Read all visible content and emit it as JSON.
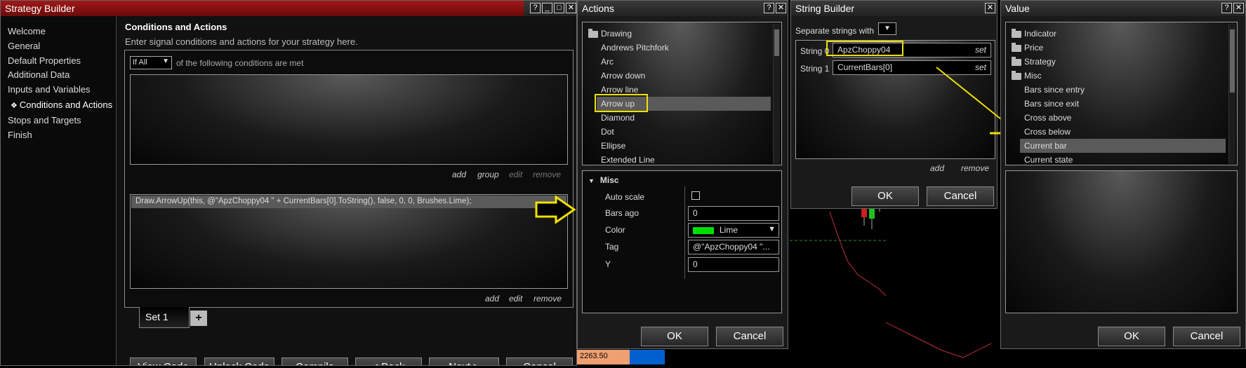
{
  "strategy_builder": {
    "title": "Strategy Builder",
    "title_buttons": [
      "?",
      "_",
      "□",
      "✕"
    ],
    "nav": [
      "Welcome",
      "General",
      "Default Properties",
      "Additional Data",
      "Inputs and Variables",
      "Conditions and Actions",
      "Stops and Targets",
      "Finish"
    ],
    "active_nav_bullet": "❖",
    "section_title": "Conditions and Actions",
    "section_subtitle": "Enter signal conditions and actions for your strategy here.",
    "condition_select": "If All",
    "condition_text": "of the following conditions are met",
    "conditions_links": {
      "add": "add",
      "group": "group",
      "edit": "edit",
      "remove": "remove"
    },
    "action_row": "Draw.ArrowUp(this, @\"ApzChoppy04 \" + CurrentBars[0].ToString(), false, 0, 0, Brushes.Lime);",
    "actions_links": {
      "add": "add",
      "edit": "edit",
      "remove": "remove"
    },
    "set_tab": "Set 1",
    "add_set": "+",
    "bottom_buttons": [
      "View Code",
      "Unlock Code",
      "Compile",
      "< Back",
      "Next >",
      "Cancel"
    ]
  },
  "actions_dialog": {
    "title": "Actions",
    "title_buttons": [
      "?",
      "✕"
    ],
    "tree": [
      "Drawing",
      "Andrews Pitchfork",
      "Arc",
      "Arrow down",
      "Arrow line",
      "Arrow up",
      "Diamond",
      "Dot",
      "Ellipse",
      "Extended Line"
    ],
    "selected": "Arrow up",
    "section": "Misc",
    "props": {
      "auto_scale_label": "Auto scale",
      "bars_ago_label": "Bars ago",
      "bars_ago_value": "0",
      "color_label": "Color",
      "color_value": "Lime",
      "tag_label": "Tag",
      "tag_value": "@\"ApzChoppy04 \"...",
      "y_label": "Y",
      "y_value": "0"
    },
    "ok": "OK",
    "cancel": "Cancel"
  },
  "string_builder": {
    "title": "String Builder",
    "close": "✕",
    "separate_label": "Separate strings with",
    "rows": [
      {
        "label": "String 0",
        "value": "ApzChoppy04",
        "set": "set"
      },
      {
        "label": "String 1",
        "value": "CurrentBars[0]",
        "set": "set"
      }
    ],
    "add": "add",
    "remove": "remove",
    "ok": "OK",
    "cancel": "Cancel"
  },
  "value_dialog": {
    "title": "Value",
    "title_buttons": [
      "?",
      "✕"
    ],
    "tree": [
      "Indicator",
      "Price",
      "Strategy",
      "Misc",
      "Bars since entry",
      "Bars since exit",
      "Cross above",
      "Cross below",
      "Current bar",
      "Current state"
    ],
    "selected": "Current bar",
    "ok": "OK",
    "cancel": "Cancel"
  },
  "chart": {
    "price_label": "2263.50"
  },
  "colors": {
    "highlight": "#f0e000",
    "lime": "#00e000",
    "selection": "#5a5a5a"
  }
}
